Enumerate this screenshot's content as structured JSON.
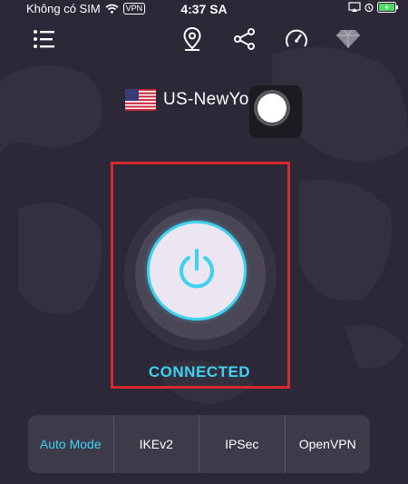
{
  "status_bar": {
    "carrier": "Không có SIM",
    "vpn": "VPN",
    "time": "4:37 SA"
  },
  "toolbar": {
    "icons": [
      "menu-icon",
      "location-pin-icon",
      "share-icon",
      "speedometer-icon",
      "diamond-icon"
    ]
  },
  "server": {
    "flag": "us-flag-icon",
    "name": "US-NewYo"
  },
  "connection": {
    "status": "CONNECTED",
    "button_icon": "power-icon",
    "accent": "#3fd1f0"
  },
  "protocols": [
    {
      "label": "Auto Mode",
      "active": true
    },
    {
      "label": "IKEv2"
    },
    {
      "label": "IPSec"
    },
    {
      "label": "OpenVPN"
    }
  ],
  "colors": {
    "background": "#2c2838",
    "accent": "#3fd1f0",
    "highlight": "#d42a2e",
    "protocol_bar": "#3d3a4a"
  }
}
